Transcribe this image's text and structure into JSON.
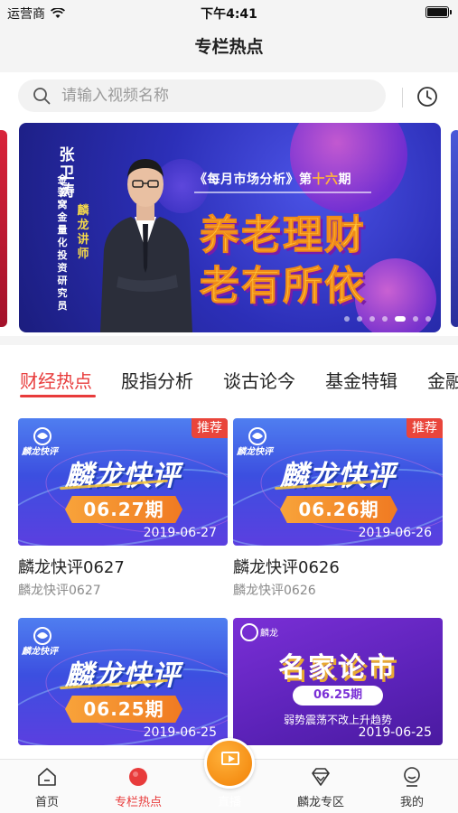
{
  "status_bar": {
    "carrier": "运营商",
    "time": "下午4:41"
  },
  "nav": {
    "title": "专栏热点"
  },
  "search": {
    "placeholder": "请输入视频名称"
  },
  "banner": {
    "name": "张卫涛",
    "name_sub": "麟龙讲师",
    "role": "金鉴窝金量化投资研究员",
    "issue_prefix": "《每月市场分析》第",
    "issue_num": "十六",
    "issue_suffix": "期",
    "title_line1": "养老理财",
    "title_line2": "老有所依",
    "dot_count": 7,
    "active_dot": 5
  },
  "tabs": [
    {
      "label": "财经热点",
      "active": true
    },
    {
      "label": "股指分析",
      "active": false
    },
    {
      "label": "谈古论今",
      "active": false
    },
    {
      "label": "基金特辑",
      "active": false
    },
    {
      "label": "金融",
      "active": false
    }
  ],
  "cards": [
    {
      "thumb_title": "麟龙快评",
      "logo_text": "麟龙快评",
      "issue": "06.27期",
      "date": "2019-06-27",
      "badge": "推荐",
      "title": "麟龙快评0627",
      "subtitle": "麟龙快评0627"
    },
    {
      "thumb_title": "麟龙快评",
      "logo_text": "麟龙快评",
      "issue": "06.26期",
      "date": "2019-06-26",
      "badge": "推荐",
      "title": "麟龙快评0626",
      "subtitle": "麟龙快评0626"
    },
    {
      "thumb_title": "麟龙快评",
      "logo_text": "麟龙快评",
      "issue": "06.25期",
      "date": "2019-06-25"
    },
    {
      "thumb_title": "名家论市",
      "logo_text": "麟龙",
      "issue": "06.25期",
      "date": "2019-06-25",
      "sub": "弱势震荡不改上升趋势"
    }
  ],
  "tab_bar": [
    {
      "label": "首页",
      "icon": "home-icon",
      "active": false
    },
    {
      "label": "专栏热点",
      "icon": "hot-dot-icon",
      "active": true
    },
    {
      "label": "直播",
      "icon": "live-play-icon",
      "active": false
    },
    {
      "label": "麟龙专区",
      "icon": "diamond-icon",
      "active": false
    },
    {
      "label": "我的",
      "icon": "profile-icon",
      "active": false
    }
  ],
  "colors": {
    "accent": "#e83b3b",
    "live": "#f48a10",
    "banner_bg": "#2c2fb8"
  }
}
